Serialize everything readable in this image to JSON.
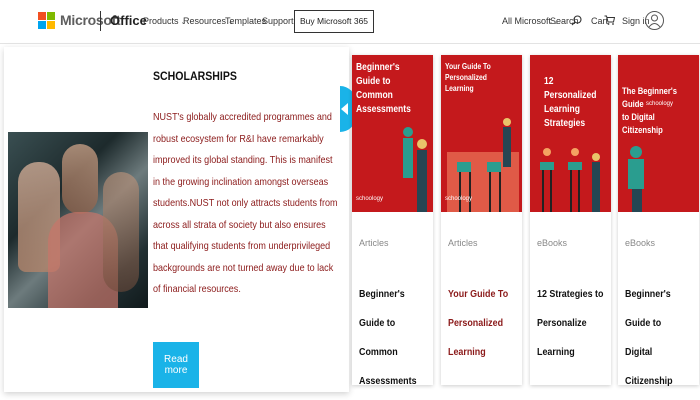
{
  "header": {
    "brand": "Microsoft",
    "product": "Office",
    "nav": [
      {
        "label": "Products",
        "has_menu": true
      },
      {
        "label": "Resources",
        "has_menu": true
      },
      {
        "label": "Templates",
        "has_menu": false
      },
      {
        "label": "Support",
        "has_menu": false
      }
    ],
    "buy_button": "Buy Microsoft 365",
    "all_microsoft": "All Microsoft",
    "search": "Search",
    "cart": "Cart",
    "signin": "Sign in"
  },
  "colors": {
    "logo_red": "#f25022",
    "logo_green": "#7fba00",
    "logo_blue": "#00a4ef",
    "logo_yellow": "#ffb900",
    "accent_blue": "#1ab3e8",
    "card_red": "#c4191c",
    "body_text_red": "#8b1a1a"
  },
  "panel": {
    "title": "SCHOLARSHIPS",
    "body": "NUST's globally accredited programmes and robust ecosystem for R&I have remarkably improved its global standing. This is manifest in the growing inclination amongst overseas students.NUST not only attracts students from across all strata of society but also ensures that qualifying students from underprivileged backgrounds are not turned away due to lack of financial resources.",
    "button": "Read more"
  },
  "cards": [
    {
      "image_caption": "Beginner's Guide to\nCommon\nAssessments",
      "brand_mark": "schoology",
      "category": "Articles",
      "title": "Beginner's Guide to\nCommon\nAssessments"
    },
    {
      "image_caption": "Your Guide To Personalized Learning",
      "brand_mark": "schoology",
      "category": "Articles",
      "title": "Your Guide To\nPersonalized\nLearning"
    },
    {
      "image_caption": "12 Personalized\nLearning Strategies",
      "brand_mark": "",
      "category": "eBooks",
      "title": "12 Strategies to\nPersonalize Learning"
    },
    {
      "image_caption": "The Beginner's Guide\nto Digital Citizenship",
      "brand_mark": "schoology",
      "category": "eBooks",
      "title": "Beginner's Guide to\nDigital Citizenship"
    }
  ]
}
